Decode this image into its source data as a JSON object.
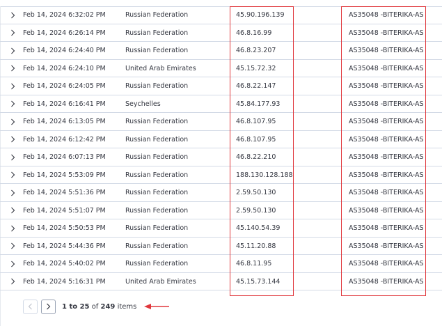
{
  "rows": [
    {
      "date": "Feb 14, 2024 6:32:02 PM",
      "country": "Russian Federation",
      "ip": "45.90.196.139",
      "asn": "AS35048 -BITERIKA-AS"
    },
    {
      "date": "Feb 14, 2024 6:26:14 PM",
      "country": "Russian Federation",
      "ip": "46.8.16.99",
      "asn": "AS35048 -BITERIKA-AS"
    },
    {
      "date": "Feb 14, 2024 6:24:40 PM",
      "country": "Russian Federation",
      "ip": "46.8.23.207",
      "asn": "AS35048 -BITERIKA-AS"
    },
    {
      "date": "Feb 14, 2024 6:24:10 PM",
      "country": "United Arab Emirates",
      "ip": "45.15.72.32",
      "asn": "AS35048 -BITERIKA-AS"
    },
    {
      "date": "Feb 14, 2024 6:24:05 PM",
      "country": "Russian Federation",
      "ip": "46.8.22.147",
      "asn": "AS35048 -BITERIKA-AS"
    },
    {
      "date": "Feb 14, 2024 6:16:41 PM",
      "country": "Seychelles",
      "ip": "45.84.177.93",
      "asn": "AS35048 -BITERIKA-AS"
    },
    {
      "date": "Feb 14, 2024 6:13:05 PM",
      "country": "Russian Federation",
      "ip": "46.8.107.95",
      "asn": "AS35048 -BITERIKA-AS"
    },
    {
      "date": "Feb 14, 2024 6:12:42 PM",
      "country": "Russian Federation",
      "ip": "46.8.107.95",
      "asn": "AS35048 -BITERIKA-AS"
    },
    {
      "date": "Feb 14, 2024 6:07:13 PM",
      "country": "Russian Federation",
      "ip": "46.8.22.210",
      "asn": "AS35048 -BITERIKA-AS"
    },
    {
      "date": "Feb 14, 2024 5:53:09 PM",
      "country": "Russian Federation",
      "ip": "188.130.128.188",
      "asn": "AS35048 -BITERIKA-AS"
    },
    {
      "date": "Feb 14, 2024 5:51:36 PM",
      "country": "Russian Federation",
      "ip": "2.59.50.130",
      "asn": "AS35048 -BITERIKA-AS"
    },
    {
      "date": "Feb 14, 2024 5:51:07 PM",
      "country": "Russian Federation",
      "ip": "2.59.50.130",
      "asn": "AS35048 -BITERIKA-AS"
    },
    {
      "date": "Feb 14, 2024 5:50:53 PM",
      "country": "Russian Federation",
      "ip": "45.140.54.39",
      "asn": "AS35048 -BITERIKA-AS"
    },
    {
      "date": "Feb 14, 2024 5:44:36 PM",
      "country": "Russian Federation",
      "ip": "45.11.20.88",
      "asn": "AS35048 -BITERIKA-AS"
    },
    {
      "date": "Feb 14, 2024 5:40:02 PM",
      "country": "Russian Federation",
      "ip": "46.8.11.95",
      "asn": "AS35048 -BITERIKA-AS"
    },
    {
      "date": "Feb 14, 2024 5:16:31 PM",
      "country": "United Arab Emirates",
      "ip": "45.15.73.144",
      "asn": "AS35048 -BITERIKA-AS"
    }
  ],
  "pagination": {
    "range": "1 to 25",
    "of_word": "of",
    "total": "249",
    "items_word": "items",
    "prev_icon": "chevron-left-icon",
    "next_icon": "chevron-right-icon"
  },
  "annotation": {
    "highlight_color": "#e0373c",
    "arrow_icon": "arrow-left-icon"
  },
  "colors": {
    "border": "#d3dae6",
    "text": "#343741"
  }
}
